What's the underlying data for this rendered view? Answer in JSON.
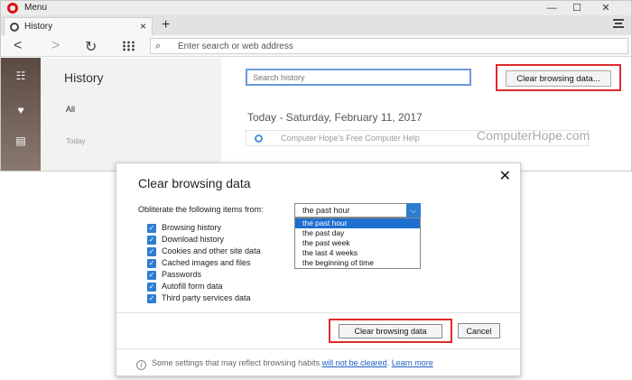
{
  "window": {
    "title": "Menu",
    "controls": [
      "—",
      "☐",
      "✕"
    ]
  },
  "tab": {
    "label": "History",
    "close": "×",
    "new_tab": "+"
  },
  "toolbar": {
    "back": "<",
    "forward": ">",
    "reload": "↻",
    "address_placeholder": "Enter search or web address"
  },
  "history_panel": {
    "title": "History",
    "nav_all": "All",
    "nav_today": "Today"
  },
  "main": {
    "search_placeholder": "Search history",
    "clear_button": "Clear browsing data...",
    "date_heading": "Today - Saturday, February 11, 2017",
    "entry_title": "Computer Hope's Free Computer Help",
    "watermark": "ComputerHope.com"
  },
  "dialog": {
    "title": "Clear browsing data",
    "close": "✕",
    "obliterate_label": "Obliterate the following items from:",
    "period_selected": "the past hour",
    "period_options": [
      "the past hour",
      "the past day",
      "the past week",
      "the last 4 weeks",
      "the beginning of time"
    ],
    "checkboxes": [
      {
        "label": "Browsing history",
        "checked": true
      },
      {
        "label": "Download history",
        "checked": true
      },
      {
        "label": "Cookies and other site data",
        "checked": true
      },
      {
        "label": "Cached images and files",
        "checked": true
      },
      {
        "label": "Passwords",
        "checked": true
      },
      {
        "label": "Autofill form data",
        "checked": true
      },
      {
        "label": "Third party services data",
        "checked": true
      }
    ],
    "clear_button": "Clear browsing data",
    "cancel_button": "Cancel",
    "footer_text": "Some settings that may reflect browsing habits",
    "footer_link1": "will not be cleared",
    "footer_period": ".",
    "footer_link2": "Learn more"
  },
  "colors": {
    "accent": "#2e7dd2",
    "highlight_box": "#e02b2b",
    "brand": "#d7141a"
  }
}
